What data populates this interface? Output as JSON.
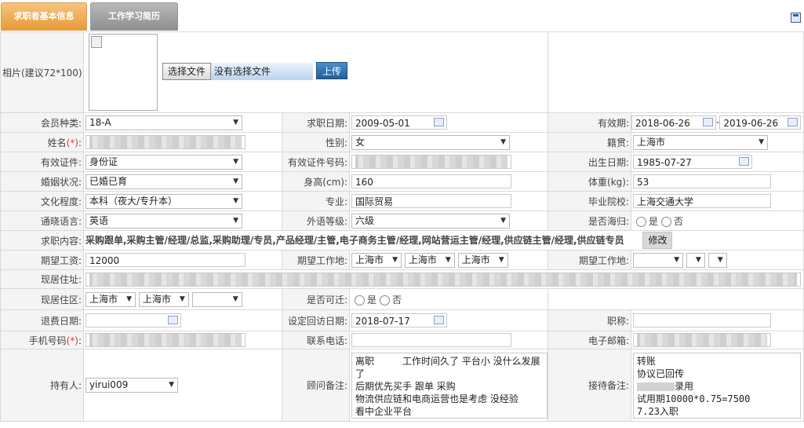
{
  "tabs": [
    "求职者基本信息",
    "工作学习简历"
  ],
  "photo_label": "相片(建议72*100):",
  "file_button": "选择文件",
  "no_file": "没有选择文件",
  "upload_button": "上传",
  "member_type": {
    "label": "会员种类:",
    "value": "18-A"
  },
  "apply_date": {
    "label": "求职日期:",
    "value": "2009-05-01"
  },
  "valid_period": {
    "label": "有效期:",
    "from": "2018-06-26",
    "sep": "-",
    "to": "2019-06-26"
  },
  "name": {
    "label": "姓名",
    "req": "(*)",
    "colon": ":"
  },
  "gender": {
    "label": "性别:",
    "value": "女"
  },
  "hometown": {
    "label": "籍贯:",
    "value": "上海市"
  },
  "id_type": {
    "label": "有效证件:",
    "value": "身份证"
  },
  "id_number": {
    "label": "有效证件号码:"
  },
  "birth_date": {
    "label": "出生日期:",
    "value": "1985-07-27"
  },
  "marital": {
    "label": "婚姻状况:",
    "value": "已婚已育"
  },
  "height": {
    "label": "身高(cm):",
    "value": "160"
  },
  "weight": {
    "label": "体重(kg):",
    "value": "53"
  },
  "education": {
    "label": "文化程度:",
    "value": "本科（夜大/专升本）"
  },
  "major": {
    "label": "专业:",
    "value": "国际贸易"
  },
  "school": {
    "label": "毕业院校:",
    "value": "上海交通大学"
  },
  "language": {
    "label": "通晓语言:",
    "value": "英语"
  },
  "foreign_level": {
    "label": "外语等级:",
    "value": "六级"
  },
  "returnee": {
    "label": "是否海归:",
    "yes": "是",
    "no": "否"
  },
  "job_content": {
    "label": "求职内容:",
    "value": "采购跟单,采购主管/经理/总监,采购助理/专员,产品经理/主管,电子商务主管/经理,网站营运主管/经理,供应链主管/经理,供应链专员",
    "edit": "修改"
  },
  "salary": {
    "label": "期望工资:",
    "value": "12000"
  },
  "work_place1": {
    "label": "期望工作地:",
    "values": [
      "上海市",
      "上海市",
      "上海市"
    ]
  },
  "work_place2": {
    "label": "期望工作地:"
  },
  "address": {
    "label": "现居住址:"
  },
  "district": {
    "label": "现居住区:",
    "values": [
      "上海市",
      "上海市",
      ""
    ]
  },
  "relocate": {
    "label": "是否可迁:",
    "yes": "是",
    "no": "否"
  },
  "refund_date": {
    "label": "退费日期:"
  },
  "visit_date": {
    "label": "设定回访日期:",
    "value": "2018-07-17"
  },
  "title": {
    "label": "职称:"
  },
  "mobile": {
    "label": "手机号码",
    "req": "(*)",
    "colon": ":"
  },
  "phone": {
    "label": "联系电话:"
  },
  "email": {
    "label": "电子邮箱:"
  },
  "holder": {
    "label": "持有人:",
    "value": "yirui009"
  },
  "consultant_note": {
    "label": "顾问备注:",
    "lines": [
      "离职　　　工作时间久了 平台小 没什么发展了",
      "后期优先买手 跟单 采购",
      "物流供应链和电商运营也是考虑 没经验",
      "看中企业平台"
    ]
  },
  "reception_note": {
    "label": "接待备注:",
    "lines": [
      "转账",
      "协议已回传",
      "录用",
      "试用期10000*0.75=7500",
      "7.23入职"
    ]
  }
}
